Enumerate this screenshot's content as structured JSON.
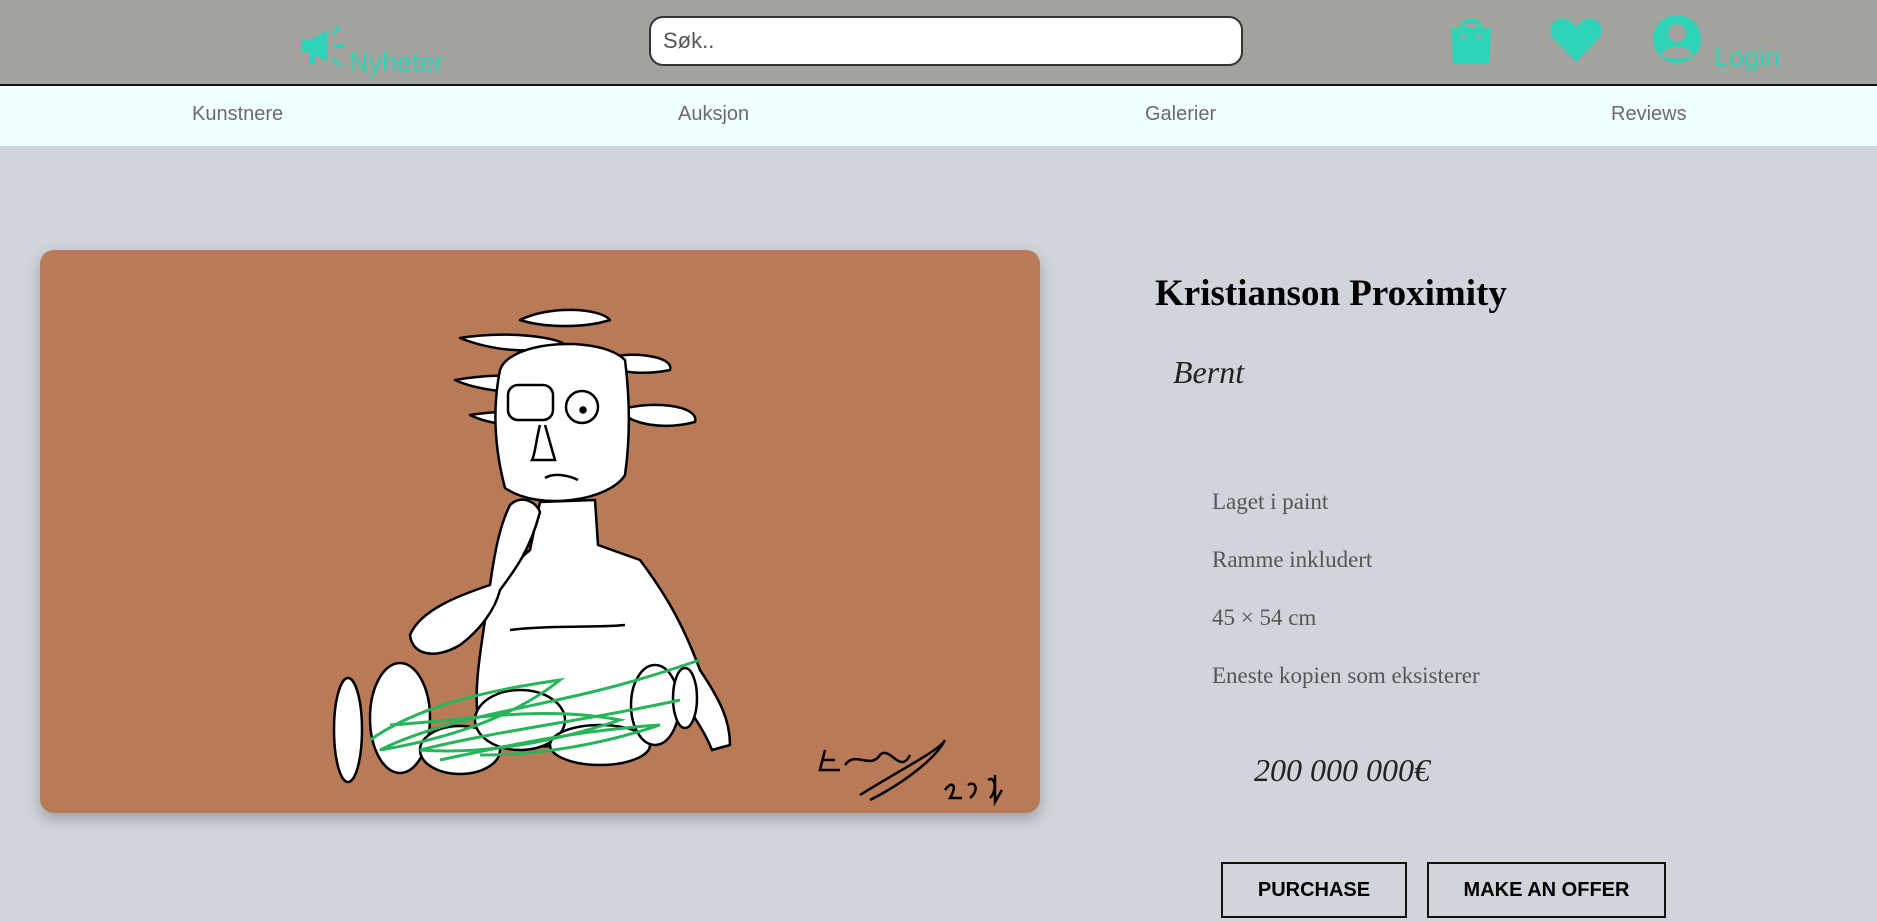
{
  "header": {
    "news_label": "Nyheter",
    "search_placeholder": "Søk..",
    "login_label": "Login",
    "accent_color": "#2ed3b8",
    "icons": [
      "megaphone-icon",
      "shopping-bag-icon",
      "heart-icon",
      "user-icon"
    ]
  },
  "nav": {
    "items": [
      {
        "label": "Kunstnere"
      },
      {
        "label": "Auksjon"
      },
      {
        "label": "Galerier"
      },
      {
        "label": "Reviews"
      }
    ]
  },
  "artwork": {
    "title": "Kristianson Proximity",
    "artist": "Bernt",
    "specs": [
      "Laget i paint",
      "Ramme inkludert",
      "45 × 54 cm",
      "Eneste kopien som eksisterer"
    ],
    "price": "200 000 000€",
    "background_color": "#b87a57"
  },
  "actions": {
    "purchase_label": "PURCHASE",
    "offer_label": "MAKE AN OFFER"
  }
}
